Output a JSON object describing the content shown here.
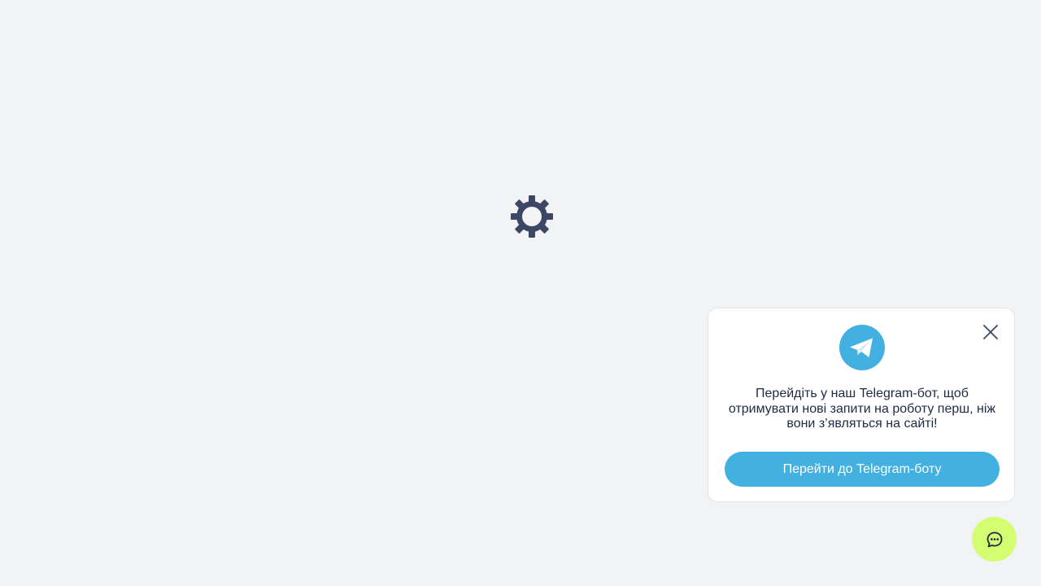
{
  "loader": {
    "icon": "gear-icon",
    "color": "#3c4766"
  },
  "telegram_popup": {
    "logo_icon": "telegram-icon",
    "close_icon": "close-icon",
    "message": "Перейдіть у наш Telegram-бот, щоб отримувати нові запити на роботу перш, ніж вони з’являться на сайті!",
    "button_label": "Перейти до Telegram-боту",
    "accent_color": "#42b0e0"
  },
  "chat_widget": {
    "icon": "chat-icon",
    "color": "#d4fd72"
  }
}
